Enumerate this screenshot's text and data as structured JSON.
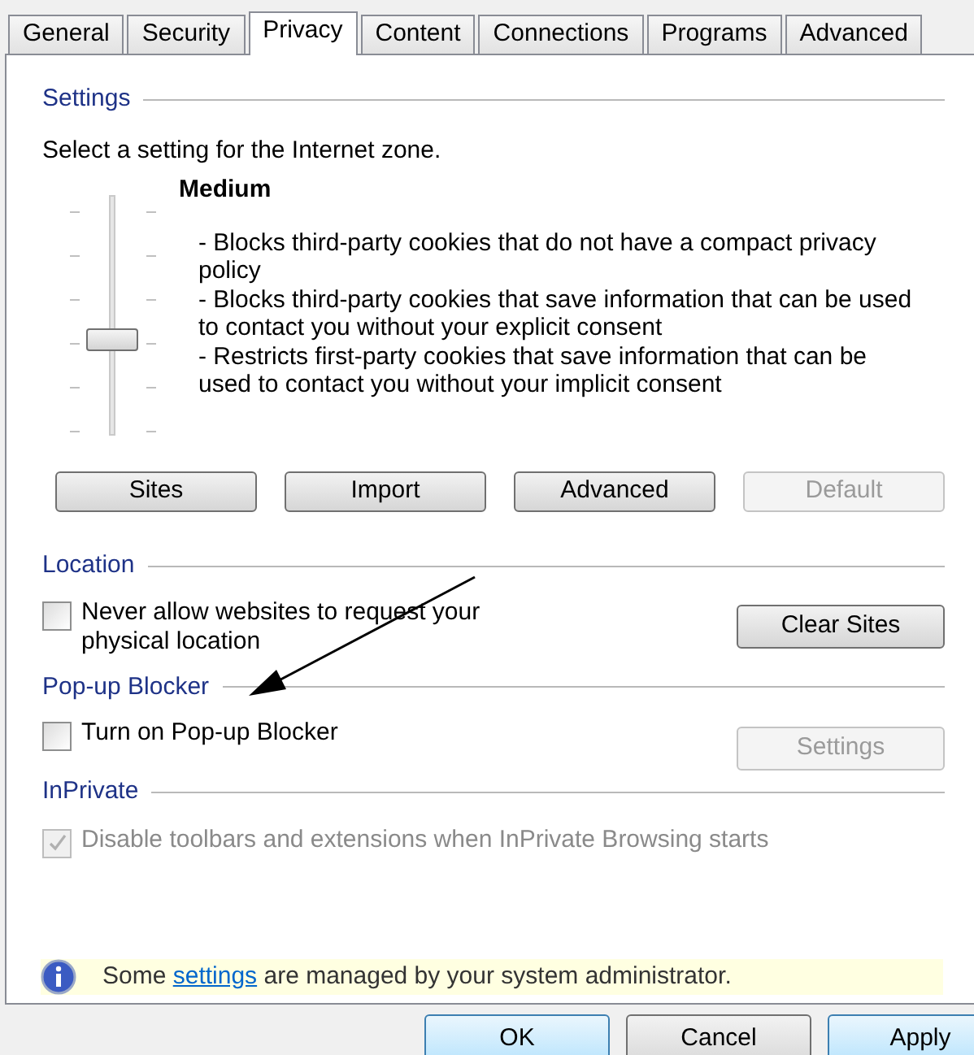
{
  "tabs": [
    {
      "label": "General",
      "selected": false
    },
    {
      "label": "Security",
      "selected": false
    },
    {
      "label": "Privacy",
      "selected": true
    },
    {
      "label": "Content",
      "selected": false
    },
    {
      "label": "Connections",
      "selected": false
    },
    {
      "label": "Programs",
      "selected": false
    },
    {
      "label": "Advanced",
      "selected": false
    }
  ],
  "settings": {
    "heading": "Settings",
    "prompt": "Select a setting for the Internet zone.",
    "slider": {
      "level": 0.4
    },
    "level_name": "Medium",
    "description": [
      "- Blocks third-party cookies that do not have a compact privacy policy",
      "- Blocks third-party cookies that save information that can be used to contact you without your explicit consent",
      "- Restricts first-party cookies that save information that can be used to contact you without your implicit consent"
    ],
    "buttons": [
      {
        "label": "Sites",
        "disabled": false
      },
      {
        "label": "Import",
        "disabled": false
      },
      {
        "label": "Advanced",
        "disabled": false
      },
      {
        "label": "Default",
        "disabled": true
      }
    ]
  },
  "location": {
    "heading": "Location",
    "checkbox": {
      "label": "Never allow websites to request your physical location",
      "checked": false,
      "disabled": false
    },
    "button": {
      "label": "Clear Sites",
      "disabled": false
    }
  },
  "popup_blocker": {
    "heading": "Pop-up Blocker",
    "checkbox": {
      "label": "Turn on Pop-up Blocker",
      "checked": false,
      "disabled": false
    },
    "button": {
      "label": "Settings",
      "disabled": true
    }
  },
  "inprivate": {
    "heading": "InPrivate",
    "checkbox": {
      "label": "Disable toolbars and extensions when InPrivate Browsing starts",
      "checked": true,
      "disabled": true
    }
  },
  "info": {
    "before": "Some",
    "link": "settings",
    "after": "are managed by your system administrator."
  },
  "dialog_buttons": [
    {
      "label": "OK",
      "default": true
    },
    {
      "label": "Cancel",
      "default": false
    },
    {
      "label": "Apply",
      "default": true
    }
  ]
}
